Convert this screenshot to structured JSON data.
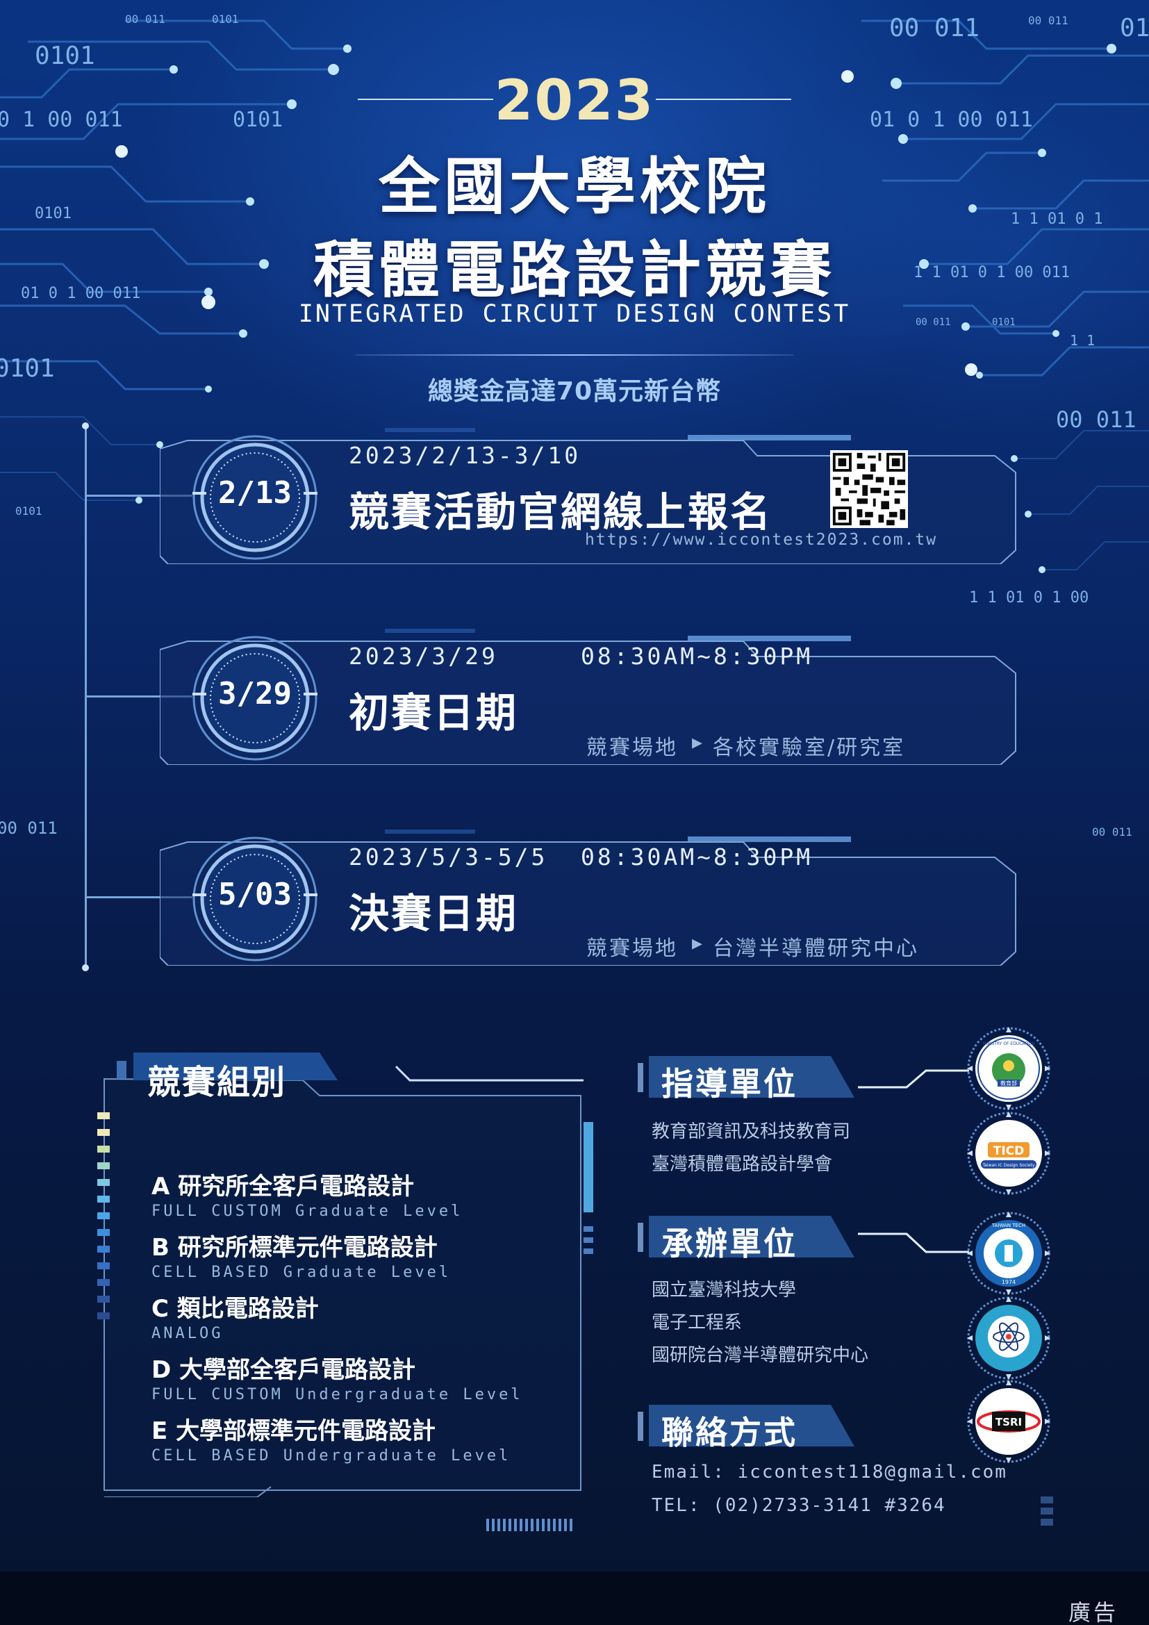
{
  "header": {
    "year": "2023",
    "title_line1": "全國大學校院",
    "title_line2": "積體電路設計競賽",
    "title_en": "INTEGRATED CIRCUIT DESIGN CONTEST",
    "prize": "總獎金高達70萬元新台幣"
  },
  "background_binary": [
    "00 011",
    "0101",
    "0101",
    "0 1  00 011",
    "0101",
    "0101",
    "01 0 1 00 011",
    "0101",
    "0101",
    "00 011",
    "00  011",
    "00 011",
    "01",
    "01 0  1  00 011",
    "1 1   01 0 1",
    "1 1   01 0 1  00 011",
    "00 011",
    "0101",
    "1 1",
    "00 011",
    "1 1   01 0 1  00",
    "00 011"
  ],
  "events": [
    {
      "badge": "2/13",
      "date": "2023/2/13-3/10",
      "time": "",
      "title": "競賽活動官網線上報名",
      "url": "https://www.iccontest2023.com.tw",
      "venue_label": "",
      "venue": ""
    },
    {
      "badge": "3/29",
      "date": "2023/3/29",
      "time": "08:30AM~8:30PM",
      "title": "初賽日期",
      "url": "",
      "venue_label": "競賽場地",
      "venue": "各校實驗室/研究室"
    },
    {
      "badge": "5/03",
      "date": "2023/5/3-5/5",
      "time": "08:30AM~8:30PM",
      "title": "決賽日期",
      "url": "",
      "venue_label": "競賽場地",
      "venue": "台灣半導體研究中心"
    }
  ],
  "categories": {
    "title": "競賽組別",
    "items": [
      {
        "zh": "A 研究所全客戶電路設計",
        "en": "FULL CUSTOM Graduate Level"
      },
      {
        "zh": "B 研究所標準元件電路設計",
        "en": "CELL BASED Graduate Level"
      },
      {
        "zh": "C 類比電路設計",
        "en": "ANALOG"
      },
      {
        "zh": "D 大學部全客戶電路設計",
        "en": "FULL CUSTOM Undergraduate Level"
      },
      {
        "zh": "E 大學部標準元件電路設計",
        "en": "CELL BASED Undergraduate Level"
      }
    ]
  },
  "guidance": {
    "title": "指導單位",
    "lines": [
      "教育部資訊及科技教育司",
      "臺灣積體電路設計學會"
    ]
  },
  "organizer": {
    "title": "承辦單位",
    "lines": [
      "國立臺灣科技大學",
      "電子工程系",
      "國研院台灣半導體研究中心"
    ]
  },
  "contact": {
    "title": "聯絡方式",
    "email": "Email: iccontest118@gmail.com",
    "tel": "TEL: (02)2733-3141 #3264"
  },
  "logos": {
    "moe_text": "MINISTRY OF EDUCATION",
    "moe_cn": "教育部",
    "ticd": "TICD",
    "ticd_sub": "Taiwan IC Design Society",
    "ntust_text": "TAIWAN TECH",
    "ntust_year": "1974",
    "tsri": "TSRI"
  },
  "footer": {
    "ad": "廣告"
  },
  "colors": {
    "background": "#0a2a6e",
    "accent": "#f3e7b5",
    "text_secondary": "#9ab9de"
  }
}
